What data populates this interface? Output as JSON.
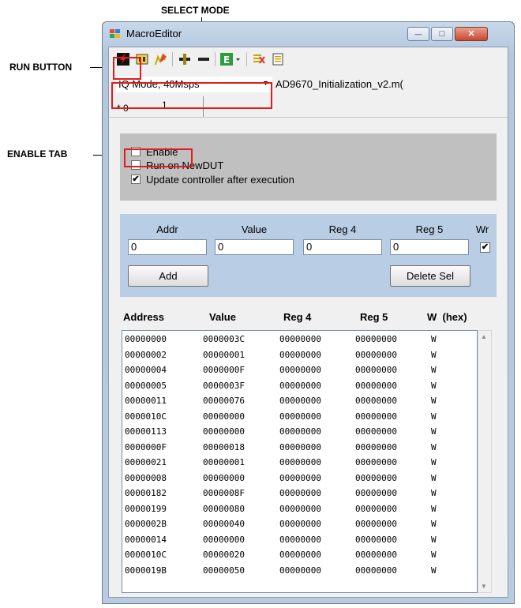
{
  "callouts": {
    "select_mode": "SELECT MODE",
    "run_button": "RUN BUTTON",
    "enable_tab": "ENABLE TAB"
  },
  "window": {
    "title": "MacroEditor"
  },
  "window_buttons": {
    "minimize": "—",
    "maximize": "□",
    "close": "✕"
  },
  "toolbar": {
    "icons": [
      "run-icon",
      "macro-icon",
      "edit-icon",
      "add-icon",
      "remove-icon",
      "export-icon",
      "clear-icon",
      "list-icon"
    ]
  },
  "mode": {
    "selected": "IQ Mode, 40Msps",
    "filename": "AD9670_Initialization_v2.m("
  },
  "tabs": [
    "* 0",
    "1"
  ],
  "options": {
    "enable": {
      "label": "Enable",
      "checked": false
    },
    "run_on_newdut": {
      "label": "Run on NewDUT",
      "checked": false
    },
    "update_controller": {
      "label": "Update controller after execution",
      "checked": true
    }
  },
  "entry": {
    "labels": {
      "addr": "Addr",
      "value": "Value",
      "reg4": "Reg 4",
      "reg5": "Reg 5",
      "wr": "Wr"
    },
    "values": {
      "addr": "0",
      "value": "0",
      "reg4": "0",
      "reg5": "0"
    },
    "wr_checked": true,
    "add_button": "Add",
    "delete_button": "Delete Sel"
  },
  "list": {
    "headers": [
      "Address",
      "Value",
      "Reg 4",
      "Reg 5",
      "W  (hex)"
    ],
    "rows": [
      [
        "00000000",
        "0000003C",
        "00000000",
        "00000000",
        "W"
      ],
      [
        "00000002",
        "00000001",
        "00000000",
        "00000000",
        "W"
      ],
      [
        "00000004",
        "0000000F",
        "00000000",
        "00000000",
        "W"
      ],
      [
        "00000005",
        "0000003F",
        "00000000",
        "00000000",
        "W"
      ],
      [
        "00000011",
        "00000076",
        "00000000",
        "00000000",
        "W"
      ],
      [
        "0000010C",
        "00000000",
        "00000000",
        "00000000",
        "W"
      ],
      [
        "00000113",
        "00000000",
        "00000000",
        "00000000",
        "W"
      ],
      [
        "0000000F",
        "00000018",
        "00000000",
        "00000000",
        "W"
      ],
      [
        "00000021",
        "00000001",
        "00000000",
        "00000000",
        "W"
      ],
      [
        "00000008",
        "00000000",
        "00000000",
        "00000000",
        "W"
      ],
      [
        "00000182",
        "0000008F",
        "00000000",
        "00000000",
        "W"
      ],
      [
        "00000199",
        "00000080",
        "00000000",
        "00000000",
        "W"
      ],
      [
        "0000002B",
        "00000040",
        "00000000",
        "00000000",
        "W"
      ],
      [
        "00000014",
        "00000000",
        "00000000",
        "00000000",
        "W"
      ],
      [
        "0000010C",
        "00000020",
        "00000000",
        "00000000",
        "W"
      ],
      [
        "0000019B",
        "00000050",
        "00000000",
        "00000000",
        "W"
      ]
    ]
  },
  "colors": {
    "highlight": "#e21b1b",
    "panel_grey": "#c0c0c0",
    "panel_blue": "#b9cde4"
  }
}
